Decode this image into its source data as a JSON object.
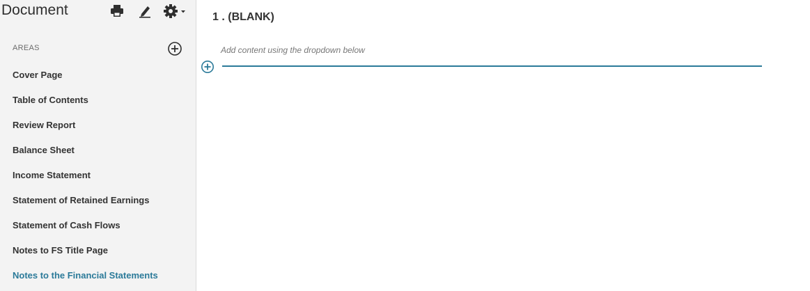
{
  "sidebar": {
    "title": "Document",
    "icons": [
      "printer-icon",
      "edit-pencil-icon",
      "gear-dropdown-icon"
    ],
    "areas_label": "AREAS",
    "items": [
      {
        "label": "Cover Page",
        "active": false
      },
      {
        "label": "Table of Contents",
        "active": false
      },
      {
        "label": "Review Report",
        "active": false
      },
      {
        "label": "Balance Sheet",
        "active": false
      },
      {
        "label": "Income Statement",
        "active": false
      },
      {
        "label": "Statement of Retained Earnings",
        "active": false
      },
      {
        "label": "Statement of Cash Flows",
        "active": false
      },
      {
        "label": "Notes to FS Title Page",
        "active": false
      },
      {
        "label": "Notes to the Financial Statements",
        "active": true
      }
    ]
  },
  "main": {
    "section_title": "1 . (BLANK)",
    "hint": "Add content using the dropdown below"
  },
  "colors": {
    "accent": "#2b7a99",
    "sidebar_bg": "#f3f3f3",
    "text": "#333333"
  }
}
